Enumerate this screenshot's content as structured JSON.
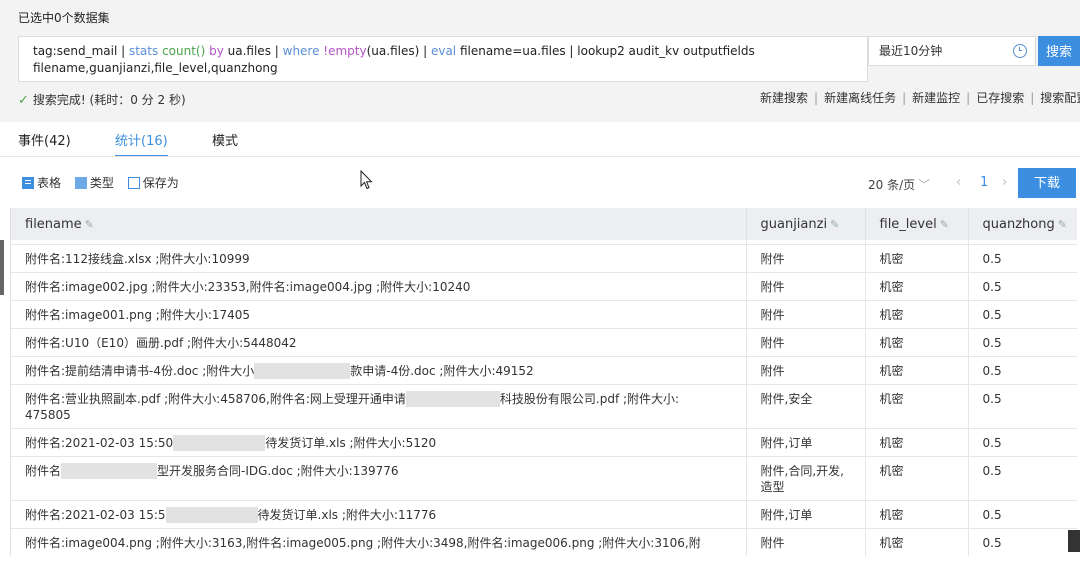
{
  "header": {
    "selected_title": "已选中0个数据集",
    "query": {
      "p1": "tag:send_mail | ",
      "p2": "stats ",
      "p3": "count()",
      "p4": " by ",
      "p5": "ua.files | ",
      "p6": "where ",
      "p7": "!empty",
      "p8": "(ua.files) | ",
      "p9": "eval",
      "p10": " filename=ua.files | lookup2 audit_kv outputfields filename,guanjianzi,file_level,quanzhong"
    },
    "time_range": "最近10分钟",
    "search_label": "搜索"
  },
  "status": {
    "done": "搜索完成!",
    "elapsed": "(耗时：0 分 2 秒)"
  },
  "links": [
    "新建搜索",
    "新建离线任务",
    "新建监控",
    "已存搜索",
    "搜索配置"
  ],
  "tabs": {
    "events": "事件(42)",
    "stats": "统计(16)",
    "mode": "模式"
  },
  "toolbar": {
    "table": "表格",
    "type": "类型",
    "save_as": "保存为"
  },
  "pager": {
    "page_size": "20 条/页",
    "current_page": "1",
    "download": "下载"
  },
  "table": {
    "columns": [
      "filename",
      "guanjianzi",
      "file_level",
      "quanzhong"
    ],
    "rows": [
      {
        "a": "附件名:112接线盒.xlsx ;附件大小:10999",
        "b": "附件",
        "c": "机密",
        "d": "0.5"
      },
      {
        "a": "附件名:image002.jpg ;附件大小:23353,附件名:image004.jpg ;附件大小:10240",
        "b": "附件",
        "c": "机密",
        "d": "0.5"
      },
      {
        "a": "附件名:image001.png ;附件大小:17405",
        "b": "附件",
        "c": "机密",
        "d": "0.5"
      },
      {
        "a": "附件名:U10（E10）画册.pdf ;附件大小:5448042",
        "b": "附件",
        "c": "机密",
        "d": "0.5"
      },
      {
        "a1": "附件名:提前结清申请书-4份.doc ;附件大小",
        "a2": "款申请-4份.doc ;附件大小:49152",
        "b": "附件",
        "c": "机密",
        "d": "0.5"
      },
      {
        "a1": "附件名:营业执照副本.pdf ;附件大小:458706,附件名:网上受理开通申请",
        "a2": "科技股份有限公司.pdf ;附件大小:",
        "a3": "475805",
        "b": "附件,安全",
        "c": "机密",
        "d": "0.5"
      },
      {
        "a1": "附件名:2021-02-03 15:50",
        "a2": "待发货订单.xls ;附件大小:5120",
        "b": "附件,订单",
        "c": "机密",
        "d": "0.5"
      },
      {
        "a1": "附件名",
        "a2": "型开发服务合同-IDG.doc ;附件大小:139776",
        "b": "附件,合同,开发,造型",
        "c": "机密",
        "d": "0.5"
      },
      {
        "a1": "附件名:2021-02-03 15:5",
        "a2": "待发货订单.xls ;附件大小:11776",
        "b": "附件,订单",
        "c": "机密",
        "d": "0.5"
      },
      {
        "a": "附件名:image004.png ;附件大小:3163,附件名:image005.png ;附件大小:3498,附件名:image006.png ;附件大小:3106,附",
        "b": "附件",
        "c": "机密",
        "d": "0.5"
      }
    ]
  }
}
